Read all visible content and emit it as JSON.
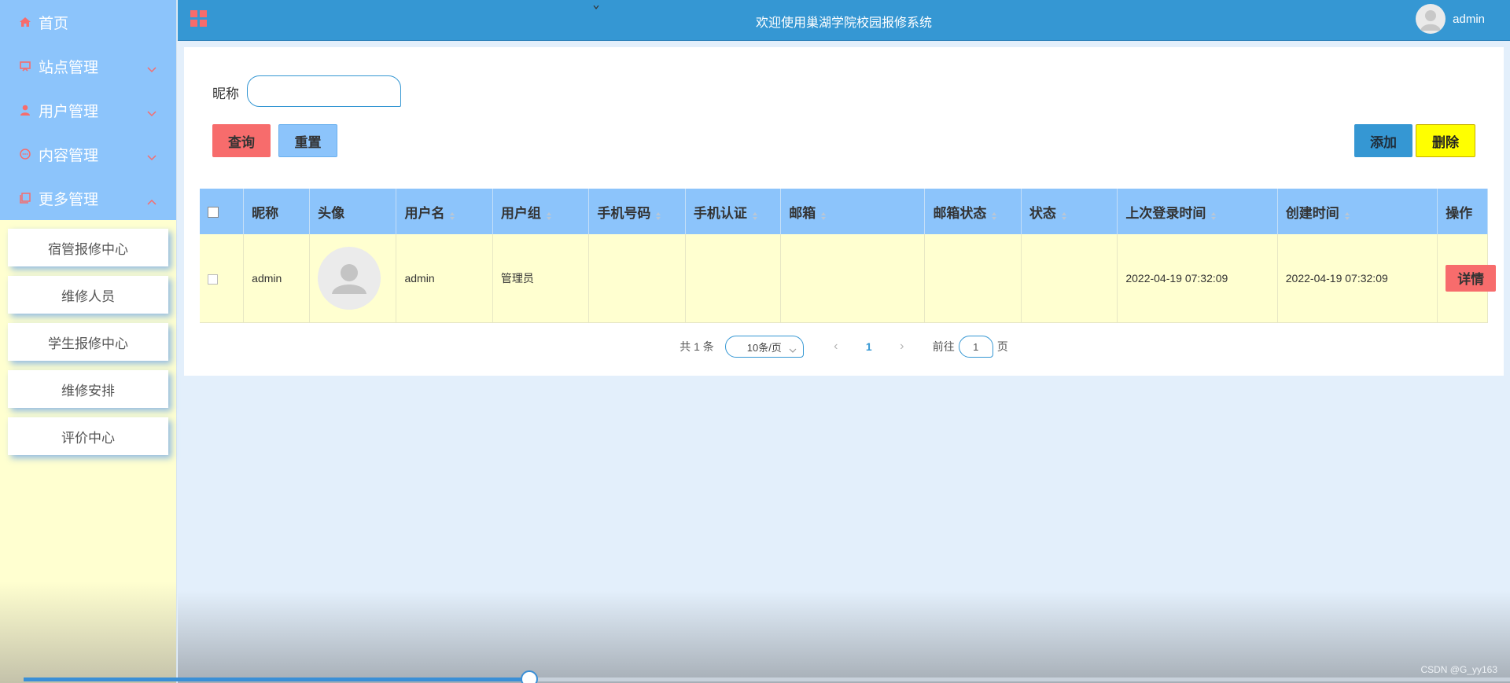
{
  "sidebar": {
    "menu": [
      {
        "label": "首页",
        "icon": "home-icon"
      },
      {
        "label": "站点管理",
        "icon": "site-icon"
      },
      {
        "label": "用户管理",
        "icon": "user-icon"
      },
      {
        "label": "内容管理",
        "icon": "content-icon"
      },
      {
        "label": "更多管理",
        "icon": "more-icon"
      }
    ],
    "submenu": [
      {
        "label": "宿管报修中心"
      },
      {
        "label": "维修人员"
      },
      {
        "label": "学生报修中心"
      },
      {
        "label": "维修安排"
      },
      {
        "label": "评价中心"
      }
    ]
  },
  "header": {
    "title": "欢迎使用巢湖学院校园报修系统",
    "username": "admin"
  },
  "search": {
    "label": "昵称",
    "value": "",
    "query_label": "查询",
    "reset_label": "重置",
    "add_label": "添加",
    "delete_label": "删除"
  },
  "table": {
    "headers": [
      "昵称",
      "头像",
      "用户名",
      "用户组",
      "手机号码",
      "手机认证",
      "邮箱",
      "邮箱状态",
      "状态",
      "上次登录时间",
      "创建时间",
      "操作"
    ],
    "rows": [
      {
        "nickname": "admin",
        "username": "admin",
        "group": "管理员",
        "phone": "",
        "phone_verified": "",
        "email": "",
        "email_status": "",
        "status": "",
        "last_login": "2022-04-19 07:32:09",
        "created": "2022-04-19 07:32:09",
        "action_label": "详情"
      }
    ]
  },
  "pagination": {
    "total_text": "共 1 条",
    "page_size": "10条/页",
    "current_page": "1",
    "goto_prefix": "前往",
    "goto_value": "1",
    "goto_suffix": "页"
  },
  "watermark": "CSDN @G_yy163",
  "colors": {
    "sidebar_menu_bg": "#8cc4fb",
    "sidebar_bg": "#ffffd0",
    "header_bg": "#3597d3",
    "danger": "#f76c6c",
    "warning": "#ffff00",
    "icon_red": "#f76c6c"
  }
}
